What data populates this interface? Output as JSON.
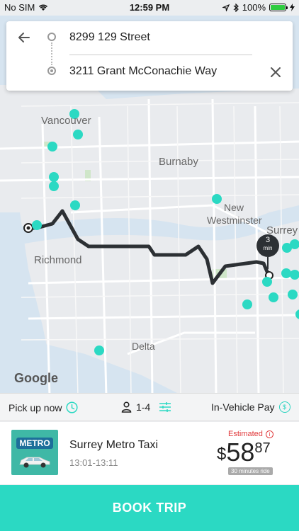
{
  "status_bar": {
    "carrier": "No SIM",
    "time": "12:59 PM",
    "battery": "100%",
    "battery_level": 1.0
  },
  "route": {
    "from": "8299 129 Street",
    "to": "3211 Grant McConachie Way"
  },
  "map": {
    "labels": {
      "vancouver": "Vancouver",
      "burnaby": "Burnaby",
      "new_westminster_1": "New",
      "new_westminster_2": "Westminster",
      "surrey": "Surrey",
      "richmond": "Richmond",
      "delta": "Delta"
    },
    "eta_badge": {
      "value": "3",
      "unit": "min"
    },
    "attribution": "Google"
  },
  "options": {
    "pickup": "Pick up now",
    "passengers": "1-4",
    "payment": "In-Vehicle Pay"
  },
  "taxi": {
    "name": "Surrey Metro Taxi",
    "time_window": "13:01-13:11",
    "logo_text": "METRO",
    "estimated_label": "Estimated",
    "price_currency": "$",
    "price_dollars": "58",
    "price_cents": "87",
    "ride_duration": "30 minutes ride"
  },
  "actions": {
    "book": "BOOK TRIP"
  },
  "colors": {
    "accent": "#2bd9c3",
    "route": "#2c3034",
    "estimate": "#e0383a"
  }
}
